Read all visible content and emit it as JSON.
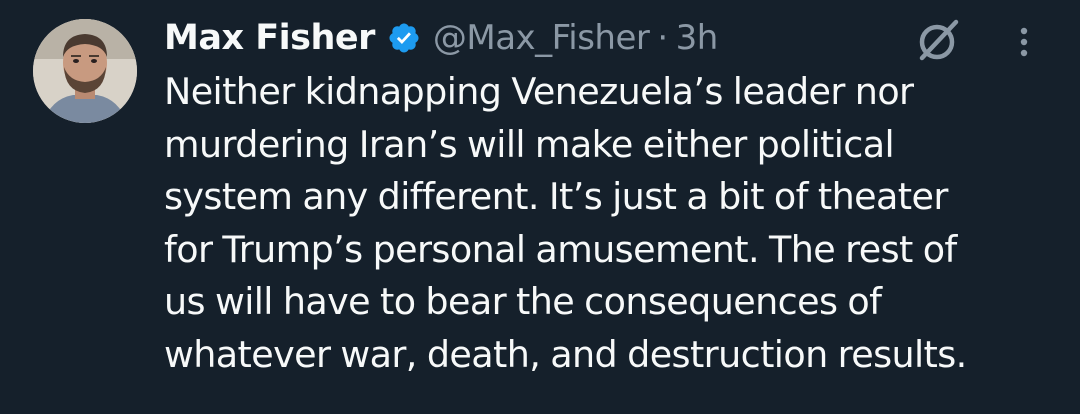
{
  "tweet": {
    "author": {
      "name": "Max Fisher",
      "handle": "@Max_Fisher",
      "verified": true
    },
    "separator": "·",
    "timestamp": "3h",
    "text_lines": [
      "Neither kidnapping Venezuela’s leader nor",
      "murdering Iran’s will make either political",
      "system any different. It’s just a bit of theater",
      "for Trump’s personal amusement. The rest of",
      "us will have to bear the consequences of",
      "whatever war, death, and destruction results."
    ]
  },
  "icons": {
    "verified": "verified-badge-icon",
    "grok": "grok-icon",
    "more": "more-options-icon"
  },
  "colors": {
    "background": "#15202b",
    "primary_text": "#f7f9f9",
    "secondary_text": "#8b98a5",
    "verified_blue": "#1d9bf0"
  }
}
